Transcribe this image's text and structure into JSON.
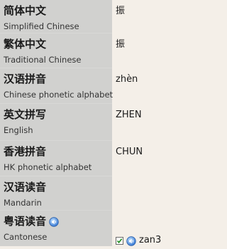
{
  "rows": [
    {
      "cn": "简体中文",
      "en": "Simplified Chinese",
      "value": "振"
    },
    {
      "cn": "繁体中文",
      "en": "Traditional Chinese",
      "value": "振"
    },
    {
      "cn": "汉语拼音",
      "en": "Chinese phonetic alphabet",
      "value": "zhèn"
    },
    {
      "cn": "英文拼写",
      "en": "English",
      "value": "ZHEN"
    },
    {
      "cn": "香港拼音",
      "en": "HK phonetic alphabet",
      "value": "CHUN"
    },
    {
      "cn": "汉语读音",
      "en": "Mandarin",
      "value": ""
    },
    {
      "cn": "粤语读音",
      "en": "Cantonese",
      "value": "zan3"
    }
  ],
  "icons": {
    "speaker": "speaker-icon",
    "checkbox": "checkbox-icon"
  },
  "colors": {
    "label_bg": "#d1d1cf",
    "value_bg": "#f4efe8",
    "icon_blue": "#3a7bd5"
  }
}
